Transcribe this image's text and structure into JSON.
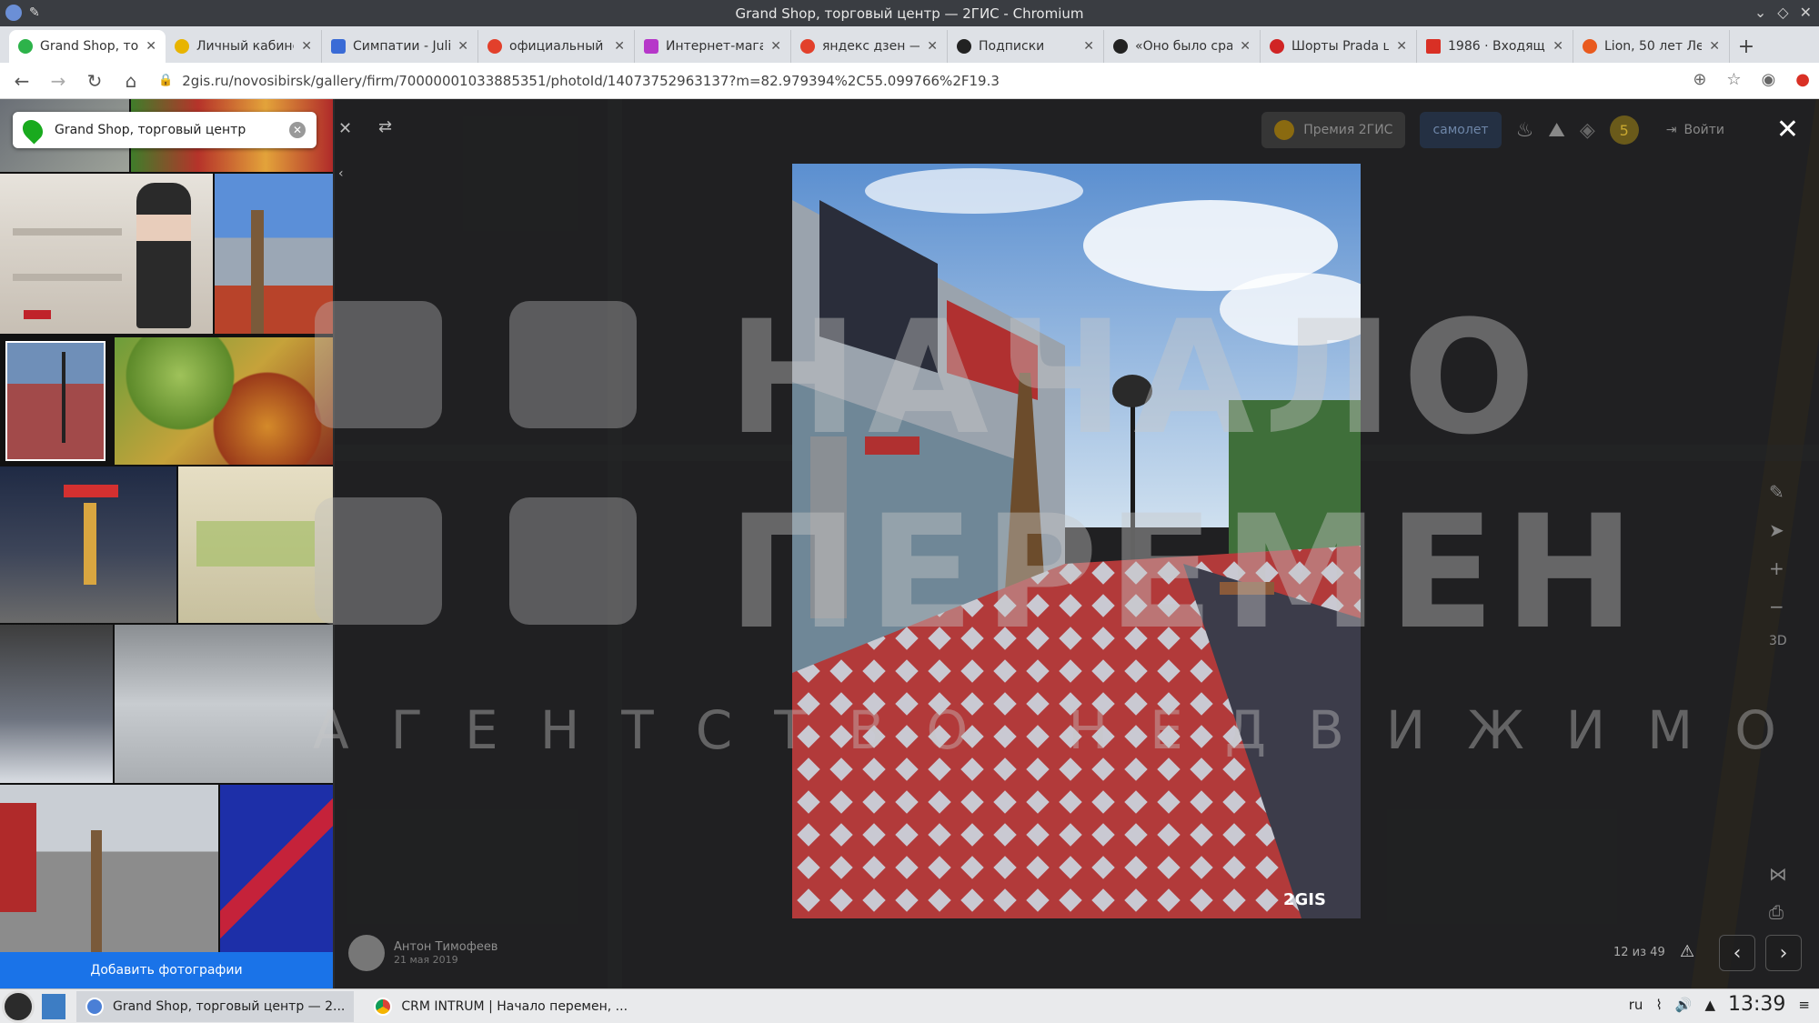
{
  "window": {
    "title": "Grand Shop, торговый центр — 2ГИС - Chromium"
  },
  "tabs": [
    {
      "label": "Grand Shop, торговый",
      "color": "#2db34a",
      "active": true
    },
    {
      "label": "Личный кабинет",
      "color": "#e8b400"
    },
    {
      "label": "Симпатии - Julia",
      "color": "#3a6bd6"
    },
    {
      "label": "официальный с",
      "color": "#e2402b"
    },
    {
      "label": "Интернет-магаз",
      "color": "#b637c9"
    },
    {
      "label": "яндекс дзен — Я",
      "color": "#e2402b"
    },
    {
      "label": "Подписки",
      "color": "#222222"
    },
    {
      "label": "«Оно было сра",
      "color": "#222222"
    },
    {
      "label": "Шорты Prada цен",
      "color": "#d02424"
    },
    {
      "label": "1986 · Входящие",
      "color": "#d93025"
    },
    {
      "label": "Lion, 50 лет Лен",
      "color": "#e95a1e"
    }
  ],
  "address_bar": {
    "url": "2gis.ru/novosibirsk/gallery/firm/70000001033885351/photoId/14073752963137?m=82.979394%2C55.099766%2F19.3"
  },
  "sidebar": {
    "search_value": "Grand Shop, торговый центр",
    "add_photo_label": "Добавить фотографии"
  },
  "viewer": {
    "premium_label": "Премия 2ГИС",
    "samolet_label": "самолет",
    "login_label": "Войти",
    "badge_count": "5",
    "photo_watermark": "2GIS",
    "author_name": "Антон Тимофеев",
    "author_date": "21 мая 2019",
    "counter": "12 из 49"
  },
  "watermark": {
    "line1": "НАЧАЛО",
    "line2": "ПЕРЕМЕН",
    "line3": "АГЕНТСТВО НЕДВИЖИМОСТИ"
  },
  "taskbar": {
    "items": [
      {
        "label": "Grand Shop, торговый центр — 2..."
      },
      {
        "label": "CRM INTRUM | Начало перемен, ..."
      }
    ],
    "lang": "ru",
    "clock": "13:39"
  }
}
